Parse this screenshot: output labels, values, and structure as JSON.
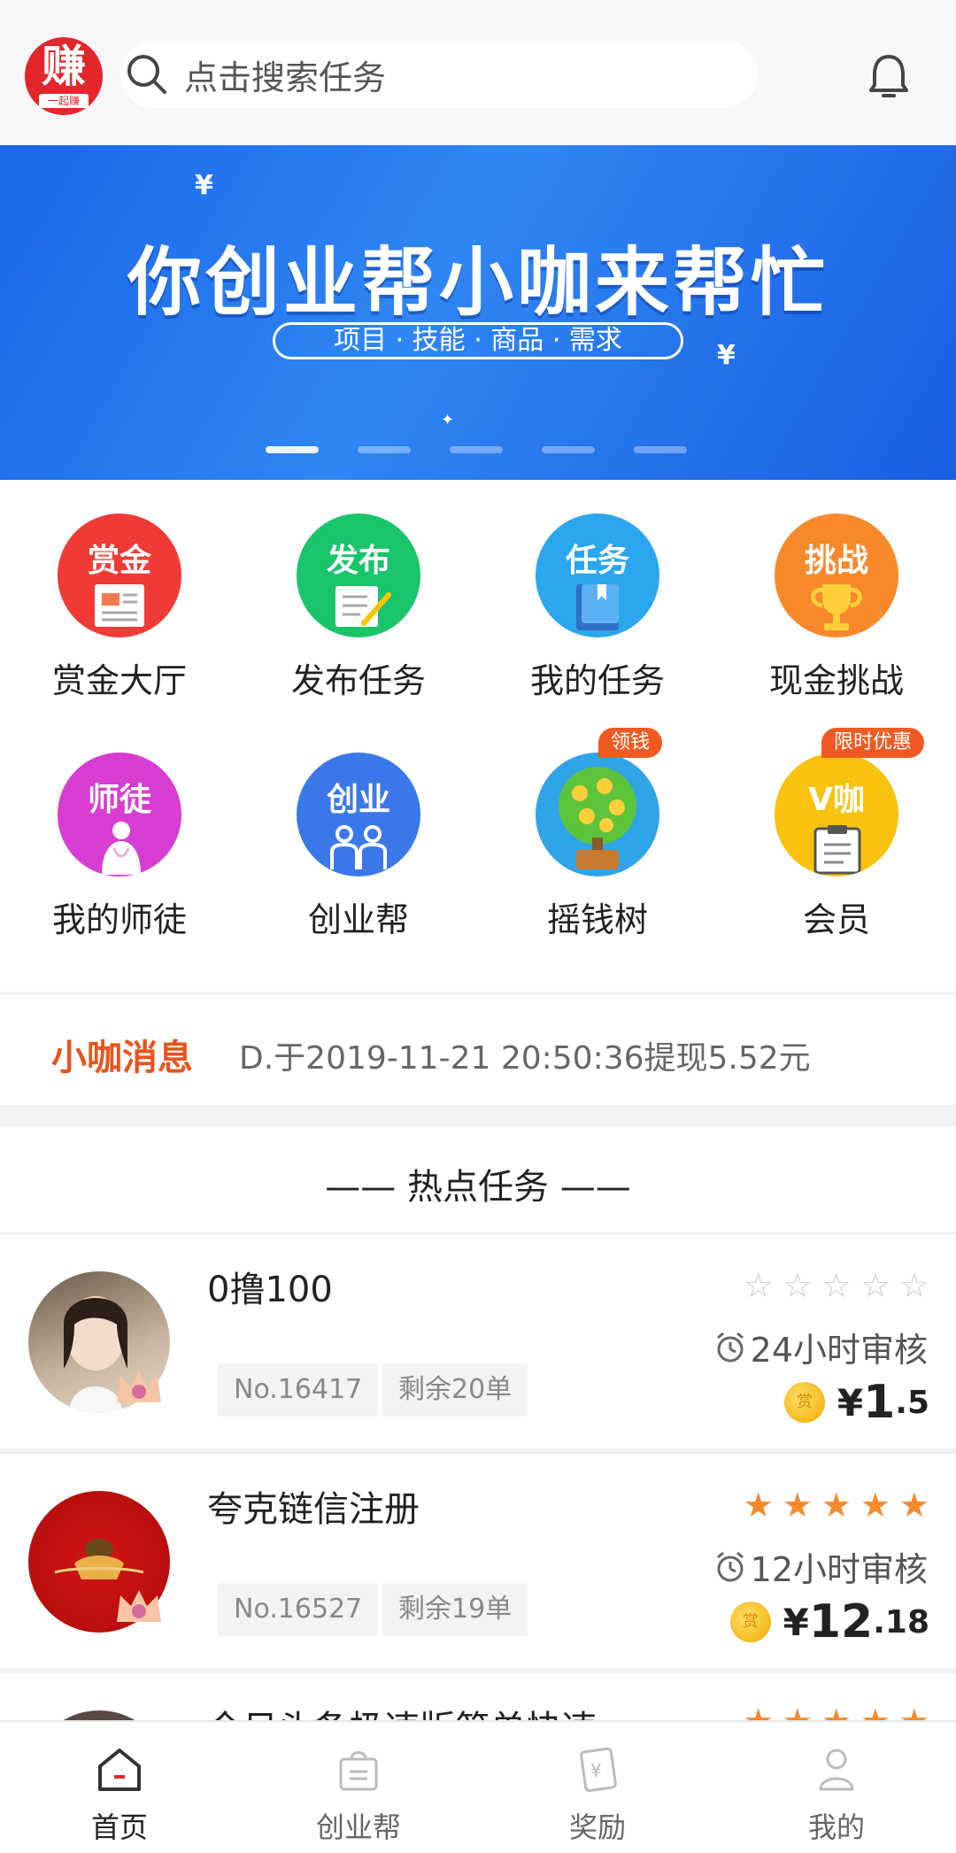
{
  "header": {
    "logo_text": "赚",
    "logo_sub": "一起赚",
    "search_placeholder": "点击搜索任务",
    "bell_icon": "bell-icon"
  },
  "banner": {
    "title": "你创业帮小咖来帮忙",
    "subtitle": "项目 · 技能 · 商品 · 需求",
    "active_index": 0,
    "dot_count": 5
  },
  "grid": {
    "items": [
      {
        "icon_text": "赏金",
        "label": "赏金大厅",
        "color": "#f03a36"
      },
      {
        "icon_text": "发布",
        "label": "发布任务",
        "color": "#19c46a"
      },
      {
        "icon_text": "任务",
        "label": "我的任务",
        "color": "#2aa6ee"
      },
      {
        "icon_text": "挑战",
        "label": "现金挑战",
        "color": "#f7892a"
      },
      {
        "icon_text": "师徒",
        "label": "我的师徒",
        "color": "#d63dd0"
      },
      {
        "icon_text": "创业",
        "label": "创业帮",
        "color": "#3a78ea"
      },
      {
        "icon_text": "",
        "label": "摇钱树",
        "color": "#2fa3e8",
        "tag": "领钱"
      },
      {
        "icon_text": "V咖",
        "label": "会员",
        "color": "#f8c20e",
        "tag": "限时优惠"
      }
    ]
  },
  "news": {
    "title": "小咖消息",
    "message": "D.于2019-11-21 20:50:36提现5.52元"
  },
  "hot": {
    "title": "—— 热点任务 ——"
  },
  "tasks": [
    {
      "name": "0撸100",
      "no": "No.16417",
      "remaining": "剩余20单",
      "review": "24小时审核",
      "yuan": "¥",
      "price_int": "1",
      "price_dec": ".5",
      "stars": 0
    },
    {
      "name": "夸克链信注册",
      "no": "No.16527",
      "remaining": "剩余19单",
      "review": "12小时审核",
      "yuan": "¥",
      "price_int": "12",
      "price_dec": ".18",
      "stars": 5
    },
    {
      "name": "今日头条极速版简单快速",
      "stars": 5
    }
  ],
  "tabbar": {
    "items": [
      {
        "label": "首页",
        "icon": "home-icon"
      },
      {
        "label": "创业帮",
        "icon": "bag-icon"
      },
      {
        "label": "奖励",
        "icon": "reward-icon"
      },
      {
        "label": "我的",
        "icon": "profile-icon"
      }
    ]
  },
  "colors": {
    "accent": "#e8541d",
    "star_on": "#f7892a",
    "star_off": "#cccccc"
  }
}
